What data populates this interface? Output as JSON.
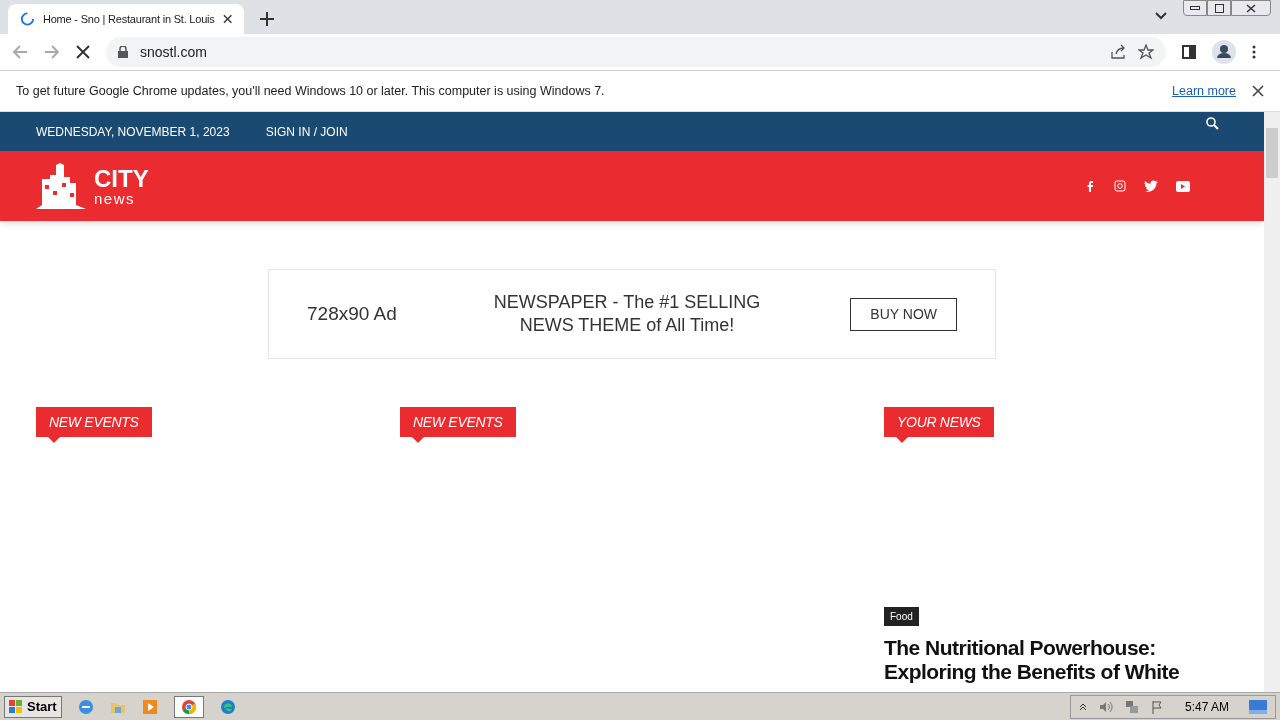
{
  "browser": {
    "tab": {
      "title": "Home - Sno | Restaurant in St. Louis",
      "loading": true
    },
    "url": "snostl.com",
    "infobar": {
      "message": "To get future Google Chrome updates, you'll need Windows 10 or later. This computer is using Windows 7.",
      "link": "Learn more"
    }
  },
  "site": {
    "topbar": {
      "date": "WEDNESDAY, NOVEMBER 1, 2023",
      "signin": "SIGN IN / JOIN"
    },
    "logo": {
      "line1": "CITY",
      "line2": "news"
    },
    "ad": {
      "size": "728x90 Ad",
      "headline": "NEWSPAPER - The #1 SELLING NEWS THEME of All Time!",
      "button": "BUY NOW"
    },
    "sections": [
      {
        "title": "NEW EVENTS"
      },
      {
        "title": "NEW EVENTS"
      },
      {
        "title": "YOUR NEWS"
      }
    ],
    "article": {
      "category": "Food",
      "headline": "The Nutritional Powerhouse: Exploring the Benefits of White"
    }
  },
  "taskbar": {
    "start": "Start",
    "clock": "5:47 AM"
  }
}
